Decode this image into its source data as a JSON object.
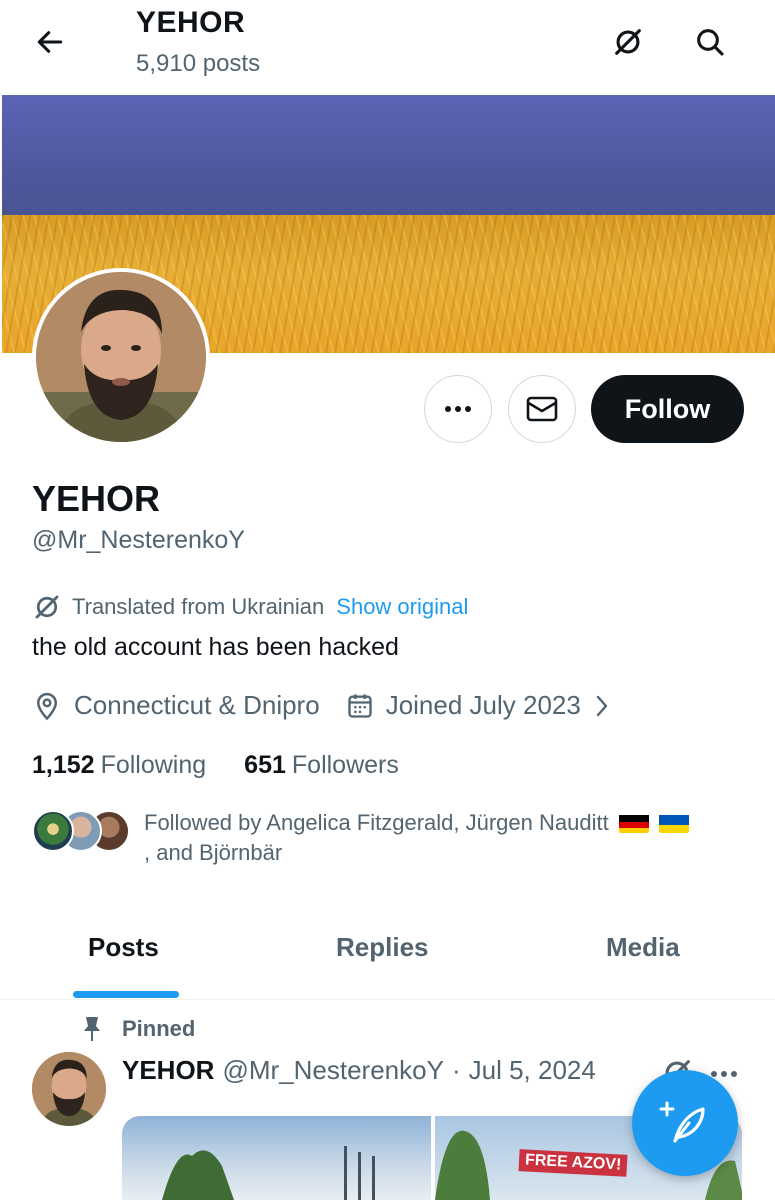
{
  "header": {
    "title": "YEHOR",
    "posts_count": "5,910 posts"
  },
  "profile": {
    "name": "YEHOR",
    "handle": "@Mr_NesterenkoY",
    "translated_from": "Translated from Ukrainian",
    "show_original": "Show original",
    "bio": "the old account has been hacked",
    "location": "Connecticut &  Dnipro",
    "joined": "Joined July 2023",
    "following_count": "1,152",
    "following_label": "Following",
    "followers_count": "651",
    "followers_label": "Followers",
    "followed_by_line1": "Followed by Angelica Fitzgerald, Jürgen Nauditt",
    "followed_by_line2": ", and Björnbär"
  },
  "actions": {
    "follow_label": "Follow"
  },
  "tabs": [
    {
      "label": "Posts"
    },
    {
      "label": "Replies"
    },
    {
      "label": "Media"
    }
  ],
  "pinned_post": {
    "pinned_label": "Pinned",
    "author": "YEHOR",
    "handle": "@Mr_NesterenkoY",
    "separator": "·",
    "date": "Jul 5, 2024",
    "media_sign_text": "FREE AZOV!"
  },
  "icons": {
    "back": "arrow-left-icon",
    "translate": "translate-icon",
    "search": "search-icon",
    "more": "more-horizontal-icon",
    "message": "envelope-icon",
    "location": "location-pin-icon",
    "calendar": "calendar-icon",
    "chevron": "chevron-right-icon",
    "pin": "pin-icon",
    "compose": "compose-feather-icon"
  },
  "colors": {
    "accent": "#1d9bf0",
    "text_primary": "#0f1419",
    "text_secondary": "#536471",
    "follow_button_bg": "#0f1419"
  }
}
